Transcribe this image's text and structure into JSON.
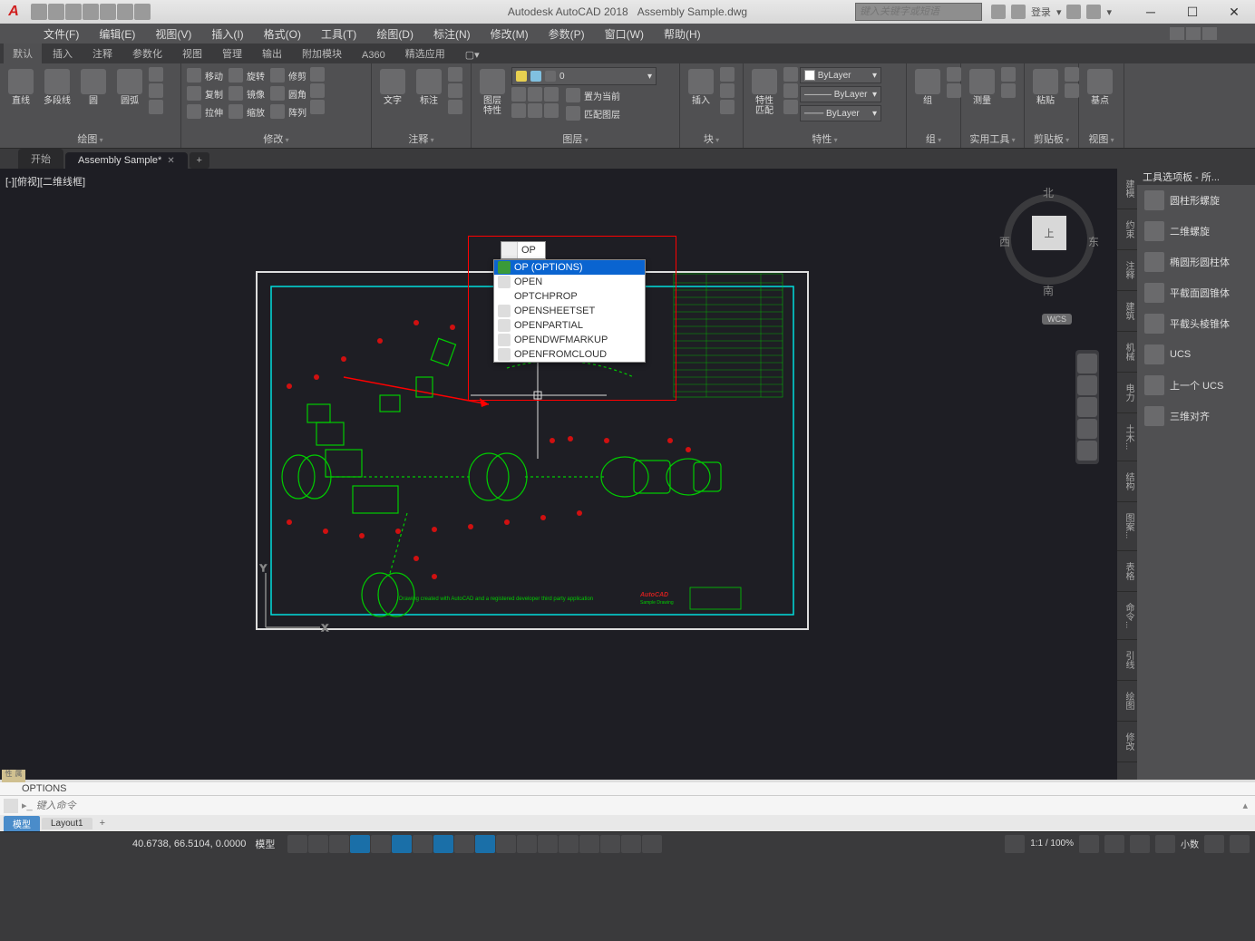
{
  "title": {
    "app": "Autodesk AutoCAD 2018",
    "file": "Assembly Sample.dwg"
  },
  "search_placeholder": "键入关键字或短语",
  "login": {
    "label": "登录"
  },
  "menus": [
    "文件(F)",
    "编辑(E)",
    "视图(V)",
    "插入(I)",
    "格式(O)",
    "工具(T)",
    "绘图(D)",
    "标注(N)",
    "修改(M)",
    "参数(P)",
    "窗口(W)",
    "帮助(H)"
  ],
  "ribbon_tabs": [
    "默认",
    "插入",
    "注释",
    "参数化",
    "视图",
    "管理",
    "输出",
    "附加模块",
    "A360",
    "精选应用"
  ],
  "panels": {
    "draw": {
      "title": "绘图",
      "btns": [
        "直线",
        "多段线",
        "圆",
        "圆弧"
      ]
    },
    "modify": {
      "title": "修改",
      "rows": [
        "移动",
        "旋转",
        "修剪",
        "复制",
        "镜像",
        "圆角",
        "拉伸",
        "缩放",
        "阵列"
      ]
    },
    "annotate": {
      "title": "注释",
      "btns": [
        "文字",
        "标注"
      ]
    },
    "layers": {
      "title": "图层",
      "btn": "图层\n特性",
      "current": "0",
      "rows": [
        "置为当前",
        "匹配图层"
      ]
    },
    "block": {
      "title": "块",
      "btn": "插入"
    },
    "props": {
      "title": "特性",
      "btn": "特性\n匹配",
      "v1": "ByLayer",
      "v2": "ByLayer",
      "v3": "ByLayer"
    },
    "group": {
      "title": "组",
      "btn": "组"
    },
    "util": {
      "title": "实用工具",
      "btn": "测量"
    },
    "clip": {
      "title": "剪贴板",
      "btn": "粘贴"
    },
    "view": {
      "title": "视图",
      "btn": "基点"
    }
  },
  "file_tabs": {
    "t1": "开始",
    "t2": "Assembly Sample*"
  },
  "viewport_label": "[-][俯视][二维线框]",
  "viewcube": {
    "face": "上",
    "n": "北",
    "s": "南",
    "e": "东",
    "w": "西",
    "wcs": "WCS"
  },
  "cmd_typed": "OP",
  "autocomplete": [
    "OP (OPTIONS)",
    "OPEN",
    "OPTCHPROP",
    "OPENSHEETSET",
    "OPENPARTIAL",
    "OPENDWFMARKUP",
    "OPENFROMCLOUD"
  ],
  "drawing_note": "Drawing created with AutoCAD and a registered developer third party application",
  "drawing_logo1": "AutoCAD",
  "drawing_logo2": "Sample Drawing",
  "vtabs": [
    "建模",
    "约束",
    "注释",
    "建筑",
    "机械",
    "电力",
    "土木...",
    "结构",
    "图案...",
    "表格",
    "命令...",
    "引线",
    "绘图",
    "修改"
  ],
  "palette_title": "工具选项板 - 所...",
  "palette_items": [
    "圆柱形螺旋",
    "二维螺旋",
    "椭圆形圆柱体",
    "平截面圆锥体",
    "平截头棱锥体",
    "UCS",
    "上一个 UCS",
    "三维对齐"
  ],
  "cmd_history": "OPTIONS",
  "cmd_placeholder": "键入命令",
  "layout_tabs": {
    "model": "模型",
    "l1": "Layout1"
  },
  "status": {
    "coords": "40.6738, 66.5104, 0.0000",
    "model": "模型",
    "zoom": "1:1 / 100%",
    "decimal": "小数"
  },
  "handle": "属性"
}
